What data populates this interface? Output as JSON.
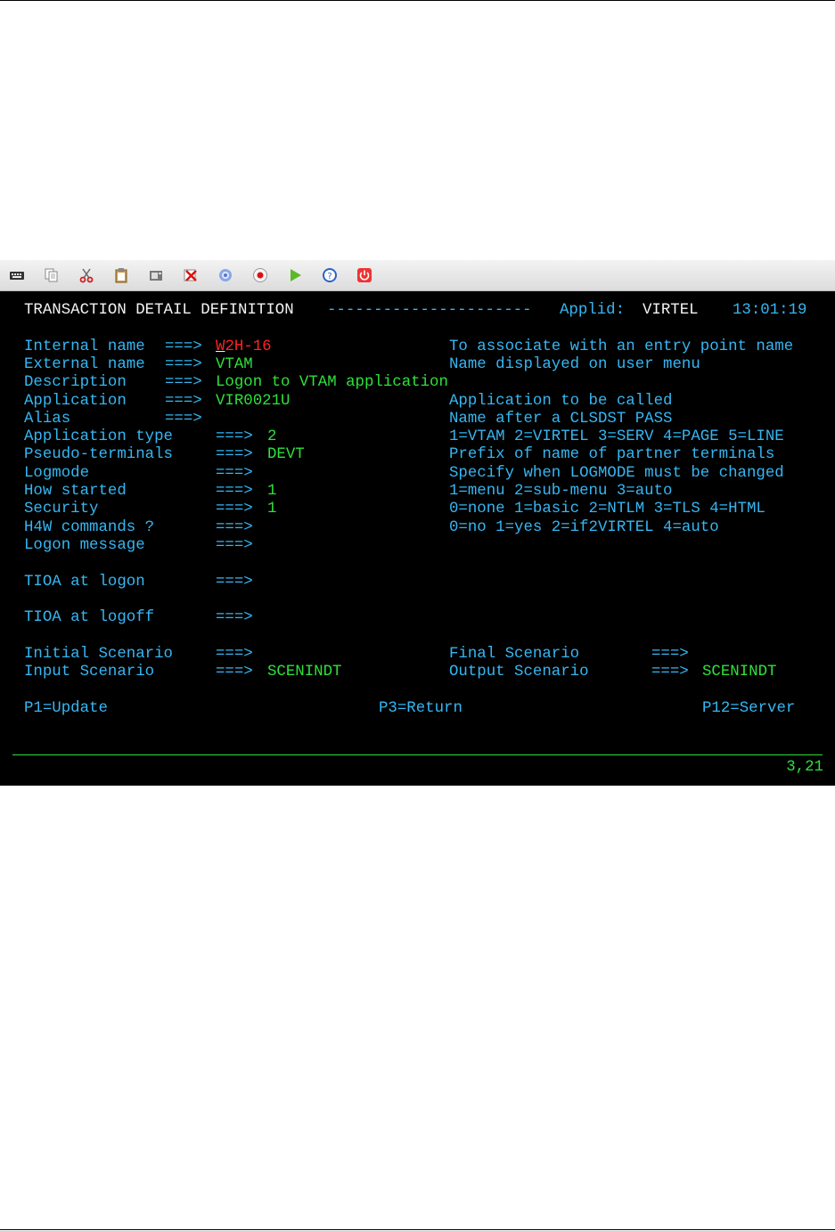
{
  "toolbar": {
    "buttons": [
      {
        "icon": "keyboard-icon"
      },
      {
        "icon": "copy-icon"
      },
      {
        "icon": "cut-icon"
      },
      {
        "icon": "paste-icon"
      },
      {
        "icon": "print-screen-icon"
      },
      {
        "icon": "disconnect-icon"
      },
      {
        "icon": "settings-gear-icon"
      },
      {
        "icon": "record-icon"
      },
      {
        "icon": "play-icon"
      },
      {
        "icon": "help-icon"
      },
      {
        "icon": "power-icon"
      }
    ]
  },
  "header": {
    "title": "TRANSACTION DETAIL DEFINITION",
    "dashes": "----------------------",
    "applid_label": "Applid:",
    "applid_value": "VIRTEL",
    "time": "13:01:19"
  },
  "fields": {
    "internal_name": {
      "label": "Internal name",
      "arrow": "===>",
      "value_first": "W",
      "value_rest": "2H-16",
      "help": "To associate with an entry point name"
    },
    "external_name": {
      "label": "External name",
      "arrow": "===>",
      "value": "VTAM",
      "help": "Name displayed on user menu"
    },
    "description": {
      "label": "Description",
      "arrow": "===>",
      "value": "Logon to VTAM application"
    },
    "application": {
      "label": "Application",
      "arrow": "===>",
      "value": "VIR0021U",
      "help": "Application to be called"
    },
    "alias": {
      "label": "Alias",
      "arrow": "===>",
      "value": "",
      "help": "Name after a CLSDST PASS"
    },
    "application_type": {
      "label": "Application type",
      "arrow": "===>",
      "value": "2",
      "help": "1=VTAM 2=VIRTEL 3=SERV 4=PAGE 5=LINE"
    },
    "pseudo_terminals": {
      "label": "Pseudo-terminals",
      "arrow": "===>",
      "value": "DEVT",
      "help": "Prefix of name of partner terminals"
    },
    "logmode": {
      "label": "Logmode",
      "arrow": "===>",
      "value": "",
      "help": "Specify when LOGMODE must be changed"
    },
    "how_started": {
      "label": "How started",
      "arrow": "===>",
      "value": "1",
      "help": "1=menu 2=sub-menu 3=auto"
    },
    "security": {
      "label": "Security",
      "arrow": "===>",
      "value": "1",
      "help": "0=none 1=basic 2=NTLM 3=TLS 4=HTML"
    },
    "h4w_commands": {
      "label": "H4W commands ?",
      "arrow": "===>",
      "value": "",
      "help": "0=no 1=yes 2=if2VIRTEL 4=auto"
    },
    "logon_message": {
      "label": "Logon message",
      "arrow": "===>",
      "value": ""
    },
    "tioa_logon": {
      "label": "TIOA at logon",
      "arrow": "===>",
      "value": ""
    },
    "tioa_logoff": {
      "label": "TIOA at logoff",
      "arrow": "===>",
      "value": ""
    },
    "initial_scenario": {
      "label": "Initial Scenario",
      "arrow": "===>",
      "value": ""
    },
    "final_scenario": {
      "label": "Final Scenario",
      "arrow": "===>",
      "value": ""
    },
    "input_scenario": {
      "label": "Input Scenario",
      "arrow": "===>",
      "value": "SCENINDT"
    },
    "output_scenario": {
      "label": "Output Scenario",
      "arrow": "===>",
      "value": "SCENINDT"
    }
  },
  "function_keys": {
    "pf1": "P1=Update",
    "pf3": "P3=Return",
    "pf12": "P12=Server"
  },
  "status": {
    "cursor_position": "3,21"
  },
  "colors": {
    "label": "#36b6f2",
    "input": "#2ee03a",
    "protected_white": "#f2f2f2",
    "error": "#ff2222",
    "background": "#000000"
  }
}
